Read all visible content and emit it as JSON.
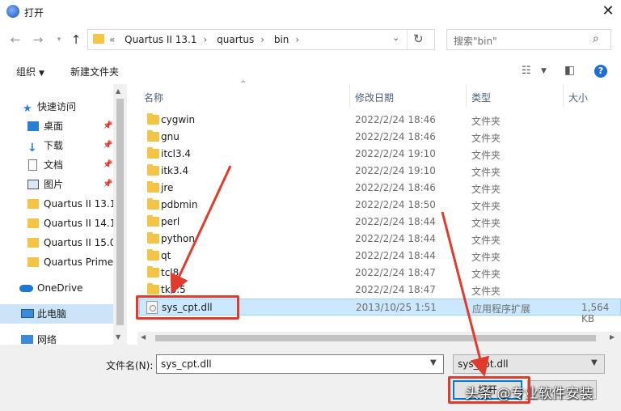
{
  "window": {
    "title": "打开"
  },
  "address": {
    "crumbs": [
      "Quartus II 13.1",
      "quartus",
      "bin"
    ],
    "overflow": "«"
  },
  "search": {
    "placeholder": "搜索\"bin\""
  },
  "toolbar": {
    "organize": "组织",
    "new_folder": "新建文件夹"
  },
  "nav_pane": {
    "items": [
      {
        "label": "快速访问",
        "icon": "star-icon",
        "pinned": false
      },
      {
        "label": "桌面",
        "icon": "desktop-icon",
        "pinned": true
      },
      {
        "label": "下载",
        "icon": "download-icon",
        "pinned": true
      },
      {
        "label": "文档",
        "icon": "document-icon",
        "pinned": true
      },
      {
        "label": "图片",
        "icon": "pictures-icon",
        "pinned": true
      },
      {
        "label": "Quartus II 13.1",
        "icon": "folder-icon",
        "pinned": false
      },
      {
        "label": "Quartus II 14.1",
        "icon": "folder-icon",
        "pinned": false
      },
      {
        "label": "Quartus II 15.0",
        "icon": "folder-icon",
        "pinned": false
      },
      {
        "label": "Quartus Prime",
        "icon": "folder-icon",
        "pinned": false
      },
      {
        "label": "OneDrive",
        "icon": "cloud-icon",
        "pinned": false
      },
      {
        "label": "此电脑",
        "icon": "computer-icon",
        "pinned": false,
        "selected": true
      },
      {
        "label": "网络",
        "icon": "network-icon",
        "pinned": false
      }
    ],
    "pin_glyph": "📌"
  },
  "columns": {
    "name": "名称",
    "date": "修改日期",
    "type": "类型",
    "size": "大小"
  },
  "files": [
    {
      "name": "cygwin",
      "date": "2022/2/24 18:46",
      "type": "文件夹",
      "size": ""
    },
    {
      "name": "gnu",
      "date": "2022/2/24 18:46",
      "type": "文件夹",
      "size": ""
    },
    {
      "name": "itcl3.4",
      "date": "2022/2/24 19:10",
      "type": "文件夹",
      "size": ""
    },
    {
      "name": "itk3.4",
      "date": "2022/2/24 19:10",
      "type": "文件夹",
      "size": ""
    },
    {
      "name": "jre",
      "date": "2022/2/24 18:46",
      "type": "文件夹",
      "size": ""
    },
    {
      "name": "pdbmin",
      "date": "2022/2/24 18:50",
      "type": "文件夹",
      "size": ""
    },
    {
      "name": "perl",
      "date": "2022/2/24 18:44",
      "type": "文件夹",
      "size": ""
    },
    {
      "name": "python",
      "date": "2022/2/24 18:44",
      "type": "文件夹",
      "size": ""
    },
    {
      "name": "qt",
      "date": "2022/2/24 18:44",
      "type": "文件夹",
      "size": ""
    },
    {
      "name": "tcl8",
      "date": "2022/2/24 18:47",
      "type": "文件夹",
      "size": ""
    },
    {
      "name": "tk8.5",
      "date": "2022/2/24 18:47",
      "type": "文件夹",
      "size": ""
    },
    {
      "name": "sys_cpt.dll",
      "date": "2013/10/25 1:51",
      "type": "应用程序扩展",
      "size": "1,564 KB",
      "selected": true
    }
  ],
  "footer": {
    "filename_label": "文件名(N):",
    "filename_value": "sys_cpt.dll",
    "filetype_value": "sys_cpt.dll",
    "open_label": "打开",
    "watermark": "头条 @专业软件安装"
  },
  "colors": {
    "annotation_red": "#e23a2b",
    "selection": "#cce8ff",
    "accent": "#0078d7"
  }
}
